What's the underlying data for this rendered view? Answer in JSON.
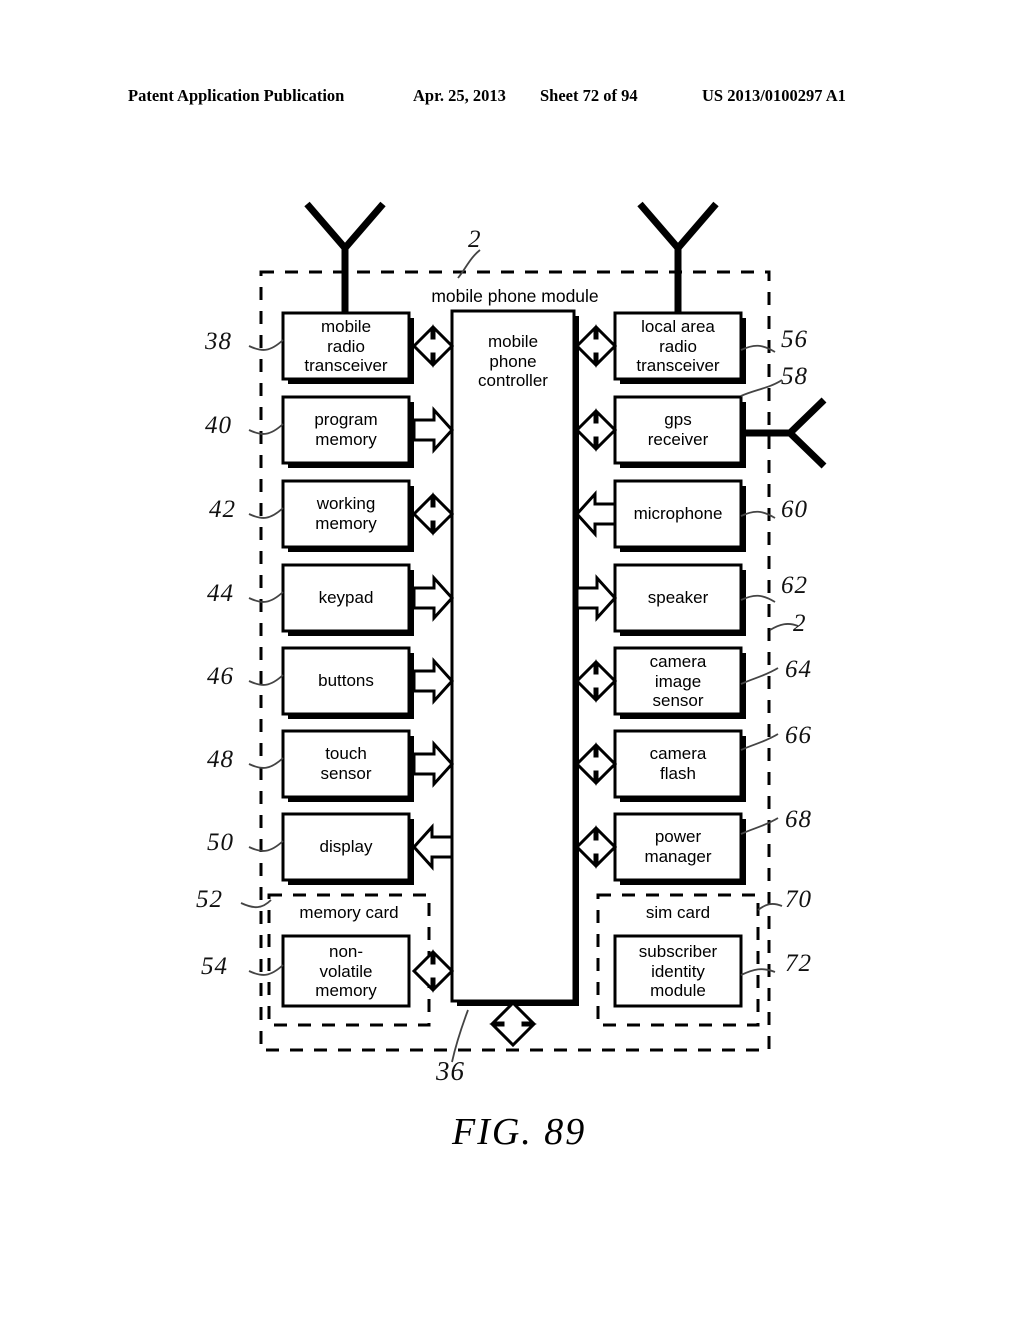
{
  "header": {
    "publication": "Patent Application Publication",
    "date": "Apr. 25, 2013",
    "sheet": "Sheet 72 of 94",
    "number": "US 2013/0100297 A1"
  },
  "figure": {
    "caption": "FIG. 89",
    "module_title": "mobile phone module",
    "memory_card_title": "memory card",
    "sim_card_title": "sim card",
    "controller_label": "mobile\nphone\ncontroller"
  },
  "blocks": {
    "left": [
      {
        "id": "mobile-radio-transceiver",
        "label": "mobile\nradio\ntransceiver",
        "ref": "38",
        "arrow": "bidirectional",
        "antenna": true
      },
      {
        "id": "program-memory",
        "label": "program\nmemory",
        "ref": "40",
        "arrow": "to-controller",
        "antenna": false
      },
      {
        "id": "working-memory",
        "label": "working\nmemory",
        "ref": "42",
        "arrow": "bidirectional",
        "antenna": false
      },
      {
        "id": "keypad",
        "label": "keypad",
        "ref": "44",
        "arrow": "to-controller",
        "antenna": false
      },
      {
        "id": "buttons",
        "label": "buttons",
        "ref": "46",
        "arrow": "to-controller",
        "antenna": false
      },
      {
        "id": "touch-sensor",
        "label": "touch\nsensor",
        "ref": "48",
        "arrow": "to-controller",
        "antenna": false
      },
      {
        "id": "display",
        "label": "display",
        "ref": "50",
        "arrow": "to-block",
        "antenna": false
      },
      {
        "id": "non-volatile-memory",
        "label": "non-\nvolatile\nmemory",
        "ref": "54",
        "arrow": "bidirectional",
        "antenna": false
      }
    ],
    "right": [
      {
        "id": "local-area-radio-transceiver",
        "label": "local area\nradio\ntransceiver",
        "ref": "56",
        "arrow": "bidirectional",
        "antenna": "top"
      },
      {
        "id": "gps-receiver",
        "label": "gps\nreceiver",
        "ref": "58",
        "arrow": "bidirectional",
        "antenna": "right"
      },
      {
        "id": "microphone",
        "label": "microphone",
        "ref": "60",
        "arrow": "to-controller",
        "antenna": false
      },
      {
        "id": "speaker",
        "label": "speaker",
        "ref": "62",
        "arrow": "to-block",
        "antenna": false
      },
      {
        "id": "camera-image-sensor",
        "label": "camera\nimage\nsensor",
        "ref": "64",
        "arrow": "bidirectional",
        "antenna": false
      },
      {
        "id": "camera-flash",
        "label": "camera\nflash",
        "ref": "66",
        "arrow": "bidirectional",
        "antenna": false
      },
      {
        "id": "power-manager",
        "label": "power\nmanager",
        "ref": "68",
        "arrow": "bidirectional",
        "antenna": false
      },
      {
        "id": "subscriber-identity-module",
        "label": "subscriber\nidentity\nmodule",
        "ref": "72",
        "arrow": "none",
        "antenna": false
      }
    ]
  },
  "refs": {
    "module_top": "2",
    "module_right": "2",
    "memory_card": "52",
    "sim_card": "70",
    "bus": "36"
  }
}
